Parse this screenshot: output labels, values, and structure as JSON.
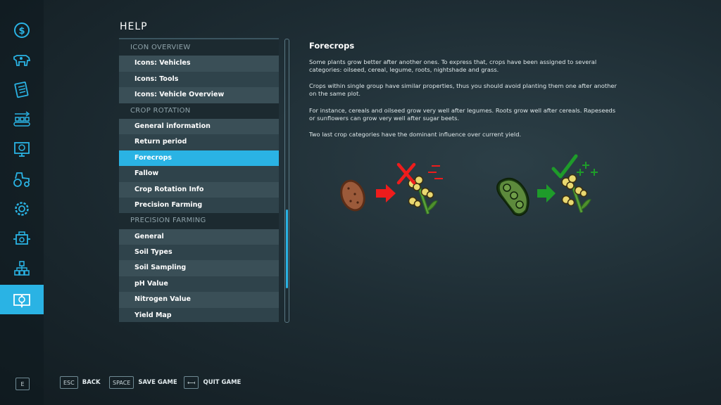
{
  "page_title": "HELP",
  "sidebar": {
    "items": [
      {
        "icon": "dollar-icon"
      },
      {
        "icon": "cow-icon"
      },
      {
        "icon": "contracts-icon"
      },
      {
        "icon": "production-chain-icon"
      },
      {
        "icon": "statistics-icon"
      },
      {
        "icon": "tractor-icon"
      },
      {
        "icon": "gear-icon"
      },
      {
        "icon": "engine-icon"
      },
      {
        "icon": "hierarchy-icon"
      },
      {
        "icon": "help-book-icon",
        "active": true
      }
    ],
    "bottom_key": "E"
  },
  "menu": {
    "sections": [
      {
        "title": "ICON OVERVIEW",
        "items": [
          "Icons: Vehicles",
          "Icons: Tools",
          "Icons: Vehicle Overview"
        ]
      },
      {
        "title": "CROP ROTATION",
        "items": [
          "General information",
          "Return period",
          "Forecrops",
          "Fallow",
          "Crop Rotation Info",
          "Precision Farming"
        ]
      },
      {
        "title": "PRECISION FARMING",
        "items": [
          "General",
          "Soil Types",
          "Soil Sampling",
          "pH Value",
          "Nitrogen Value",
          "Yield Map"
        ]
      }
    ],
    "selected": "Forecrops"
  },
  "content": {
    "title": "Forecrops",
    "paragraphs": [
      "Some plants grow better after another ones. To express that, crops have been assigned to several categories: oilseed, cereal, legume, roots, nightshade and grass.",
      "Crops within single group have similar properties, thus you should avoid planting them one after another on the same plot.",
      "For instance, cereals and oilseed grow very well after legumes. Roots grow well after cereals. Rapeseeds or sunflowers can grow very well after sugar beets.",
      "Two last crop categories have the dominant influence over current yield."
    ]
  },
  "illustration": {
    "bad_example": {
      "from": "potato-icon",
      "arrow": "red-arrow-icon",
      "to": "rapeseed-icon",
      "marker": "red-cross-minus-icon"
    },
    "good_example": {
      "from": "soybean-pod-icon",
      "arrow": "green-arrow-icon",
      "to": "rapeseed-icon",
      "marker": "green-check-plus-icon"
    },
    "colors": {
      "bad": "#ee1c1c",
      "good": "#1e9b2a"
    }
  },
  "footer": {
    "buttons": [
      {
        "key": "ESC",
        "label": "BACK"
      },
      {
        "key": "SPACE",
        "label": "SAVE GAME"
      },
      {
        "key": "⟻",
        "label": "QUIT GAME"
      }
    ]
  },
  "colors": {
    "accent": "#2ab3e4"
  }
}
